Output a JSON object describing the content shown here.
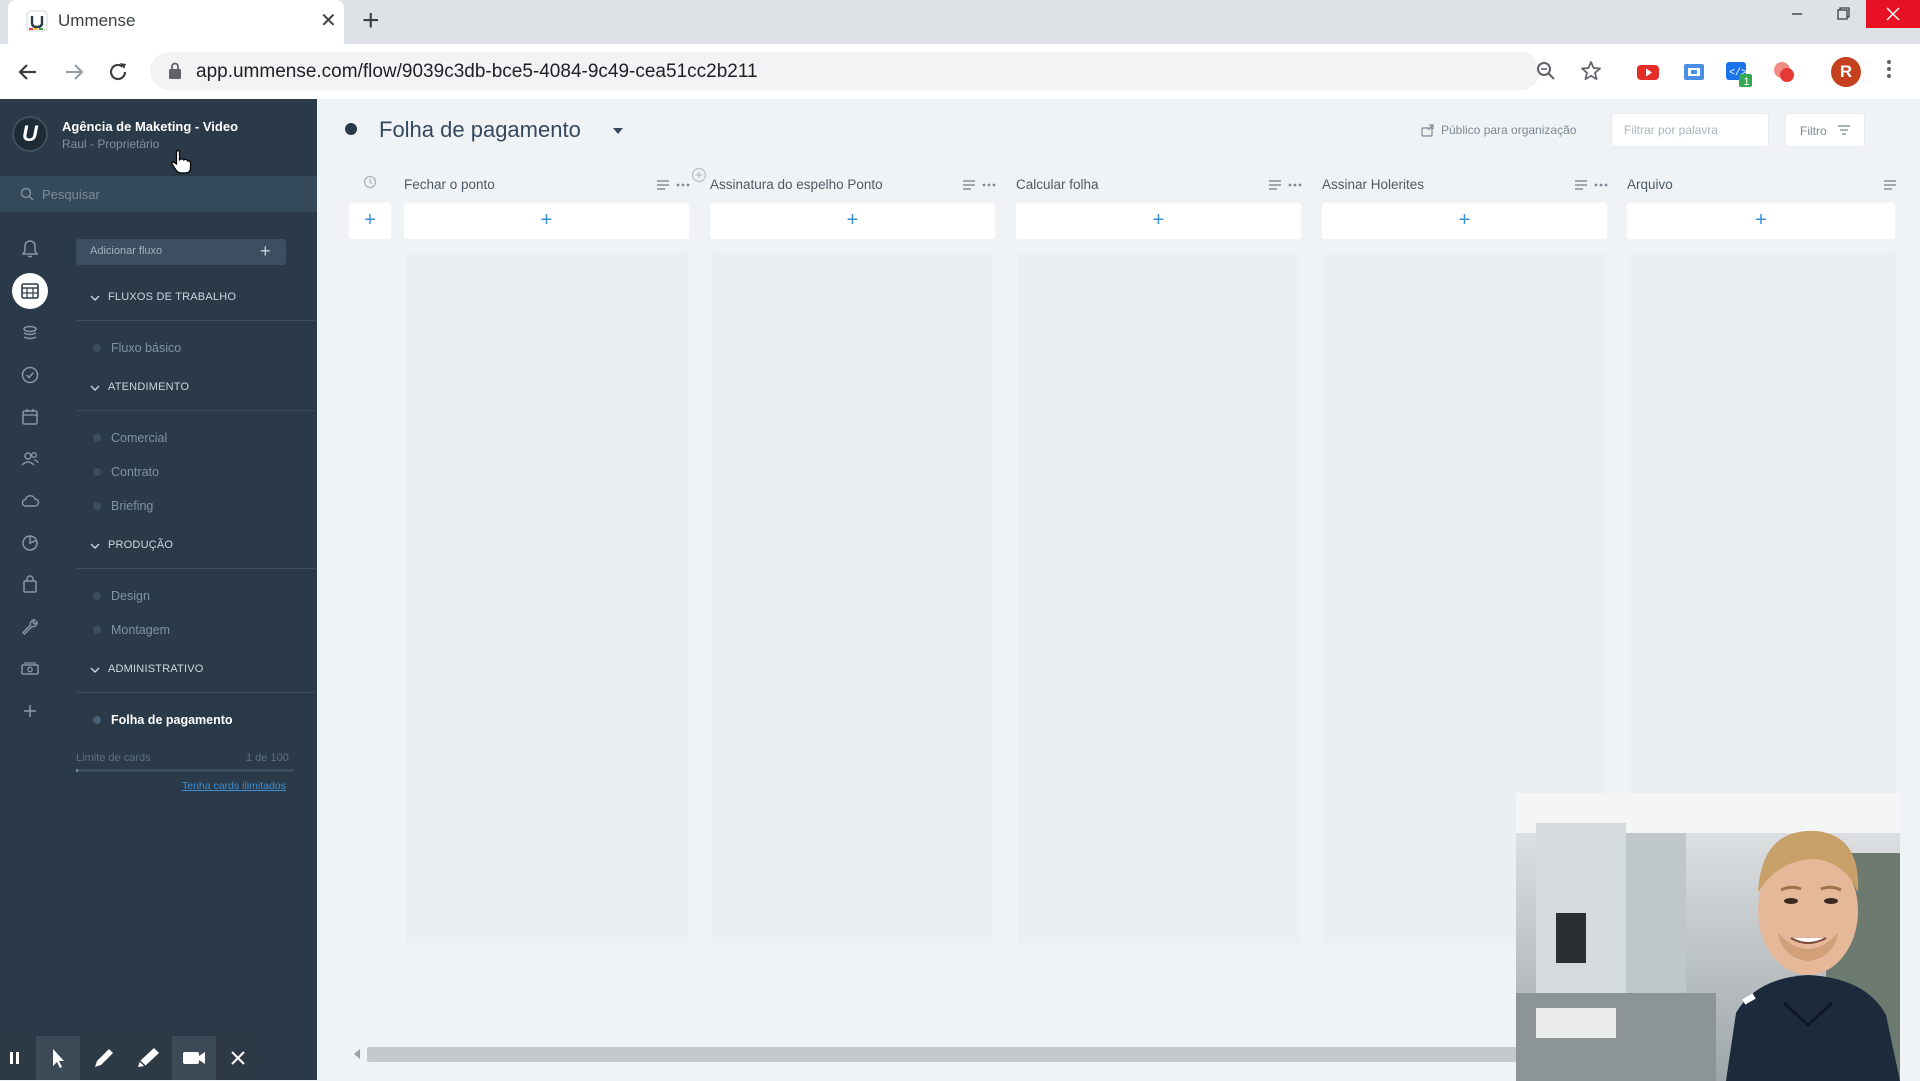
{
  "browser": {
    "tab_title": "Ummense",
    "url": "app.ummense.com/flow/9039c3db-bce5-4084-9c49-cea51cc2b211",
    "avatar_initial": "R",
    "extension_badge": "1",
    "new_tab_label": "+",
    "close_tab_label": "✕"
  },
  "sidebar": {
    "logo_letter": "U",
    "org_name": "Agência de Maketing - Video",
    "org_role": "Raul - Proprietário",
    "search_placeholder": "Pesquisar",
    "add_flow_label": "Adicionar fluxo",
    "add_flow_plus": "+",
    "sections": [
      {
        "title": "FLUXOS DE TRABALHO",
        "items": [
          "Fluxo básico"
        ]
      },
      {
        "title": "ATENDIMENTO",
        "items": [
          "Comercial",
          "Contrato",
          "Briefing"
        ]
      },
      {
        "title": "PRODUÇÃO",
        "items": [
          "Design",
          "Montagem"
        ]
      },
      {
        "title": "ADMINISTRATIVO",
        "items": [
          "Folha de pagamento"
        ]
      }
    ],
    "limit_label": "Limite de cards",
    "limit_count": "1 de 100",
    "limit_fraction": 0.01,
    "unlimited_link": "Tenha cards ilimitados",
    "rail_icons": [
      "bell-icon",
      "board-icon",
      "layers-icon",
      "check-circle-icon",
      "calendar-icon",
      "contacts-icon",
      "cloud-icon",
      "pie-chart-icon",
      "bag-icon",
      "wrench-icon",
      "money-icon",
      "plus-icon"
    ]
  },
  "board": {
    "title": "Folha de pagamento",
    "visibility": "Público para organização",
    "filter_placeholder": "Filtrar por palavra",
    "filter_button": "Filtro",
    "add_symbol": "+",
    "columns": [
      {
        "title": "Fechar o ponto"
      },
      {
        "title": "Assinatura do espelho Ponto"
      },
      {
        "title": "Calcular folha"
      },
      {
        "title": "Assinar Holerites"
      },
      {
        "title": "Arquivo"
      }
    ]
  },
  "colors": {
    "sidebar_bg": "#2b3a48",
    "main_bg": "#f0f3f6",
    "accent": "#3a8fd4",
    "avatar": "#c5401f"
  }
}
